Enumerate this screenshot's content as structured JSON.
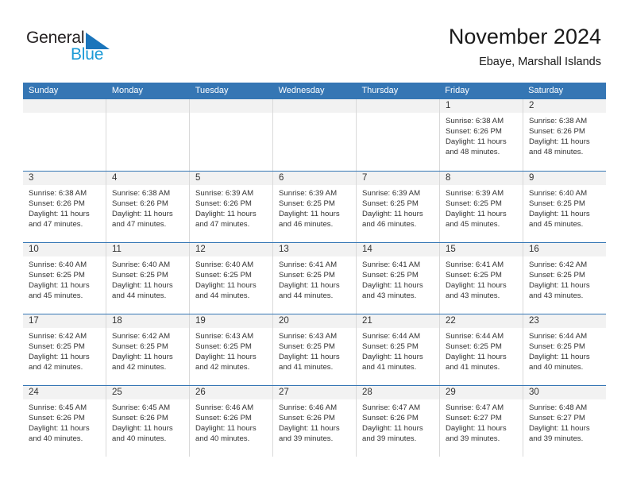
{
  "brand": {
    "name_part1": "General",
    "name_part2": "Blue",
    "triangle_icon": "blue-triangle-icon",
    "accent_color": "#1b75bb",
    "accent_color_light": "#1b9ad6"
  },
  "header": {
    "title": "November 2024",
    "subtitle": "Ebaye, Marshall Islands"
  },
  "colors": {
    "header_row_bg": "#3576b4",
    "date_band_bg": "#f2f2f2",
    "cell_border": "#d9d9d9",
    "text": "#333333"
  },
  "calendar": {
    "weekday_headers": [
      "Sunday",
      "Monday",
      "Tuesday",
      "Wednesday",
      "Thursday",
      "Friday",
      "Saturday"
    ],
    "weeks": [
      [
        {
          "date": "",
          "empty": true
        },
        {
          "date": "",
          "empty": true
        },
        {
          "date": "",
          "empty": true
        },
        {
          "date": "",
          "empty": true
        },
        {
          "date": "",
          "empty": true
        },
        {
          "date": "1",
          "sunrise": "Sunrise: 6:38 AM",
          "sunset": "Sunset: 6:26 PM",
          "daylight": "Daylight: 11 hours and 48 minutes."
        },
        {
          "date": "2",
          "sunrise": "Sunrise: 6:38 AM",
          "sunset": "Sunset: 6:26 PM",
          "daylight": "Daylight: 11 hours and 48 minutes."
        }
      ],
      [
        {
          "date": "3",
          "sunrise": "Sunrise: 6:38 AM",
          "sunset": "Sunset: 6:26 PM",
          "daylight": "Daylight: 11 hours and 47 minutes."
        },
        {
          "date": "4",
          "sunrise": "Sunrise: 6:38 AM",
          "sunset": "Sunset: 6:26 PM",
          "daylight": "Daylight: 11 hours and 47 minutes."
        },
        {
          "date": "5",
          "sunrise": "Sunrise: 6:39 AM",
          "sunset": "Sunset: 6:26 PM",
          "daylight": "Daylight: 11 hours and 47 minutes."
        },
        {
          "date": "6",
          "sunrise": "Sunrise: 6:39 AM",
          "sunset": "Sunset: 6:25 PM",
          "daylight": "Daylight: 11 hours and 46 minutes."
        },
        {
          "date": "7",
          "sunrise": "Sunrise: 6:39 AM",
          "sunset": "Sunset: 6:25 PM",
          "daylight": "Daylight: 11 hours and 46 minutes."
        },
        {
          "date": "8",
          "sunrise": "Sunrise: 6:39 AM",
          "sunset": "Sunset: 6:25 PM",
          "daylight": "Daylight: 11 hours and 45 minutes."
        },
        {
          "date": "9",
          "sunrise": "Sunrise: 6:40 AM",
          "sunset": "Sunset: 6:25 PM",
          "daylight": "Daylight: 11 hours and 45 minutes."
        }
      ],
      [
        {
          "date": "10",
          "sunrise": "Sunrise: 6:40 AM",
          "sunset": "Sunset: 6:25 PM",
          "daylight": "Daylight: 11 hours and 45 minutes."
        },
        {
          "date": "11",
          "sunrise": "Sunrise: 6:40 AM",
          "sunset": "Sunset: 6:25 PM",
          "daylight": "Daylight: 11 hours and 44 minutes."
        },
        {
          "date": "12",
          "sunrise": "Sunrise: 6:40 AM",
          "sunset": "Sunset: 6:25 PM",
          "daylight": "Daylight: 11 hours and 44 minutes."
        },
        {
          "date": "13",
          "sunrise": "Sunrise: 6:41 AM",
          "sunset": "Sunset: 6:25 PM",
          "daylight": "Daylight: 11 hours and 44 minutes."
        },
        {
          "date": "14",
          "sunrise": "Sunrise: 6:41 AM",
          "sunset": "Sunset: 6:25 PM",
          "daylight": "Daylight: 11 hours and 43 minutes."
        },
        {
          "date": "15",
          "sunrise": "Sunrise: 6:41 AM",
          "sunset": "Sunset: 6:25 PM",
          "daylight": "Daylight: 11 hours and 43 minutes."
        },
        {
          "date": "16",
          "sunrise": "Sunrise: 6:42 AM",
          "sunset": "Sunset: 6:25 PM",
          "daylight": "Daylight: 11 hours and 43 minutes."
        }
      ],
      [
        {
          "date": "17",
          "sunrise": "Sunrise: 6:42 AM",
          "sunset": "Sunset: 6:25 PM",
          "daylight": "Daylight: 11 hours and 42 minutes."
        },
        {
          "date": "18",
          "sunrise": "Sunrise: 6:42 AM",
          "sunset": "Sunset: 6:25 PM",
          "daylight": "Daylight: 11 hours and 42 minutes."
        },
        {
          "date": "19",
          "sunrise": "Sunrise: 6:43 AM",
          "sunset": "Sunset: 6:25 PM",
          "daylight": "Daylight: 11 hours and 42 minutes."
        },
        {
          "date": "20",
          "sunrise": "Sunrise: 6:43 AM",
          "sunset": "Sunset: 6:25 PM",
          "daylight": "Daylight: 11 hours and 41 minutes."
        },
        {
          "date": "21",
          "sunrise": "Sunrise: 6:44 AM",
          "sunset": "Sunset: 6:25 PM",
          "daylight": "Daylight: 11 hours and 41 minutes."
        },
        {
          "date": "22",
          "sunrise": "Sunrise: 6:44 AM",
          "sunset": "Sunset: 6:25 PM",
          "daylight": "Daylight: 11 hours and 41 minutes."
        },
        {
          "date": "23",
          "sunrise": "Sunrise: 6:44 AM",
          "sunset": "Sunset: 6:25 PM",
          "daylight": "Daylight: 11 hours and 40 minutes."
        }
      ],
      [
        {
          "date": "24",
          "sunrise": "Sunrise: 6:45 AM",
          "sunset": "Sunset: 6:26 PM",
          "daylight": "Daylight: 11 hours and 40 minutes."
        },
        {
          "date": "25",
          "sunrise": "Sunrise: 6:45 AM",
          "sunset": "Sunset: 6:26 PM",
          "daylight": "Daylight: 11 hours and 40 minutes."
        },
        {
          "date": "26",
          "sunrise": "Sunrise: 6:46 AM",
          "sunset": "Sunset: 6:26 PM",
          "daylight": "Daylight: 11 hours and 40 minutes."
        },
        {
          "date": "27",
          "sunrise": "Sunrise: 6:46 AM",
          "sunset": "Sunset: 6:26 PM",
          "daylight": "Daylight: 11 hours and 39 minutes."
        },
        {
          "date": "28",
          "sunrise": "Sunrise: 6:47 AM",
          "sunset": "Sunset: 6:26 PM",
          "daylight": "Daylight: 11 hours and 39 minutes."
        },
        {
          "date": "29",
          "sunrise": "Sunrise: 6:47 AM",
          "sunset": "Sunset: 6:27 PM",
          "daylight": "Daylight: 11 hours and 39 minutes."
        },
        {
          "date": "30",
          "sunrise": "Sunrise: 6:48 AM",
          "sunset": "Sunset: 6:27 PM",
          "daylight": "Daylight: 11 hours and 39 minutes."
        }
      ]
    ]
  }
}
